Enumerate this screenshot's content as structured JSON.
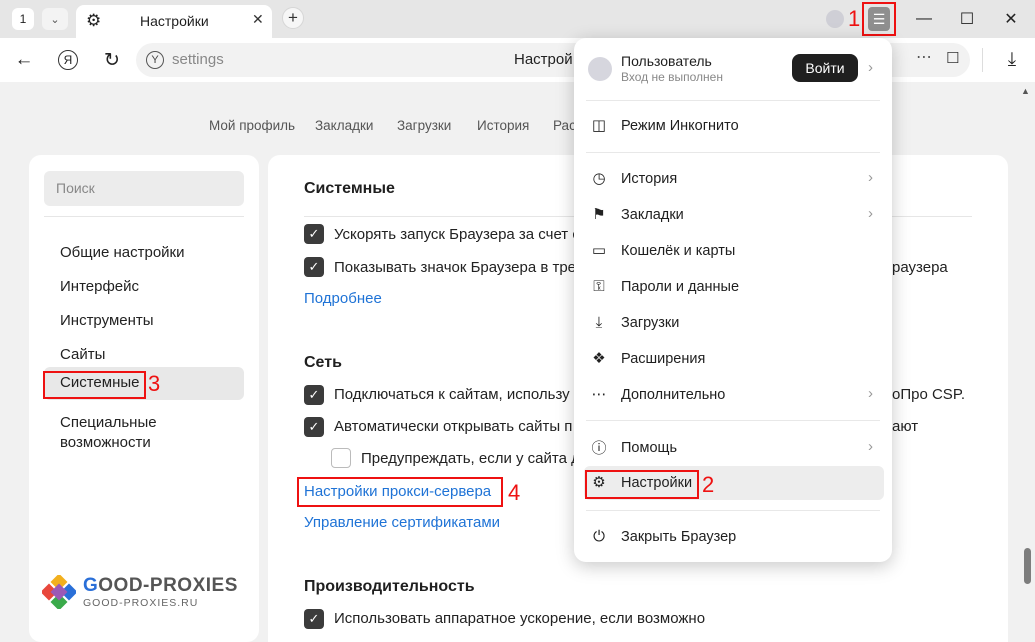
{
  "tabs": {
    "count": "1",
    "dropdown_icon": "chevron-down-icon",
    "active_title": "Настройки",
    "new_tab_icon": "plus-icon"
  },
  "toolbar": {
    "url": "settings",
    "page_title": "Настрой"
  },
  "top_nav": [
    "Мой профиль",
    "Закладки",
    "Загрузки",
    "История",
    "Рас"
  ],
  "sidebar": {
    "search_placeholder": "Поиск",
    "items": [
      "Общие настройки",
      "Интерфейс",
      "Инструменты",
      "Сайты",
      "Системные",
      "Специальные возможности"
    ],
    "active_index": 4,
    "logo": {
      "brand_a": "G",
      "brand_b": "OOD-",
      "brand_c": "PROXIES",
      "sub": "GOOD-PROXIES.RU"
    }
  },
  "content": {
    "section_title": "Системные",
    "rows_system": [
      {
        "text": "Ускорять запуск Браузера за счет с",
        "checked": true
      },
      {
        "text": "Показывать значок Браузера в тре",
        "checked": true
      }
    ],
    "row2_tail": "раузера",
    "more_link": "Подробнее",
    "network_title": "Сеть",
    "rows_network": [
      {
        "text": "Подключаться к сайтам, использу",
        "tail": "оПро CSP.",
        "checked": true
      },
      {
        "text": "Автоматически открывать сайты п",
        "tail": "ают",
        "checked": true
      },
      {
        "text": "Предупреждать, если у сайта д",
        "tail": "",
        "checked": false
      }
    ],
    "proxy_link": "Настройки прокси-сервера",
    "certs_link": "Управление сертификатами",
    "perf_title": "Производительность",
    "perf_row": {
      "text": "Использовать аппаратное ускорение, если возможно",
      "checked": true
    }
  },
  "markers": {
    "m1": "1",
    "m2": "2",
    "m3": "3",
    "m4": "4"
  },
  "menu": {
    "user_name": "Пользователь",
    "user_status": "Вход не выполнен",
    "login_label": "Войти",
    "items": [
      {
        "label": "Режим Инкогнито",
        "icon": "incognito-icon"
      },
      {
        "label": "История",
        "icon": "history-icon",
        "chevron": true
      },
      {
        "label": "Закладки",
        "icon": "bookmark-icon",
        "chevron": true
      },
      {
        "label": "Кошелёк и карты",
        "icon": "wallet-icon"
      },
      {
        "label": "Пароли и данные",
        "icon": "key-icon"
      },
      {
        "label": "Загрузки",
        "icon": "download-icon"
      },
      {
        "label": "Расширения",
        "icon": "puzzle-icon"
      },
      {
        "label": "Дополнительно",
        "icon": "more-icon",
        "chevron": true
      },
      {
        "label": "Помощь",
        "icon": "help-icon",
        "chevron": true
      },
      {
        "label": "Настройки",
        "icon": "gear-icon"
      },
      {
        "label": "Закрыть Браузер",
        "icon": "power-icon"
      }
    ]
  },
  "colors": {
    "accent_link": "#1f73d6",
    "marker": "#e11111",
    "checkbox": "#3b3b3b"
  }
}
